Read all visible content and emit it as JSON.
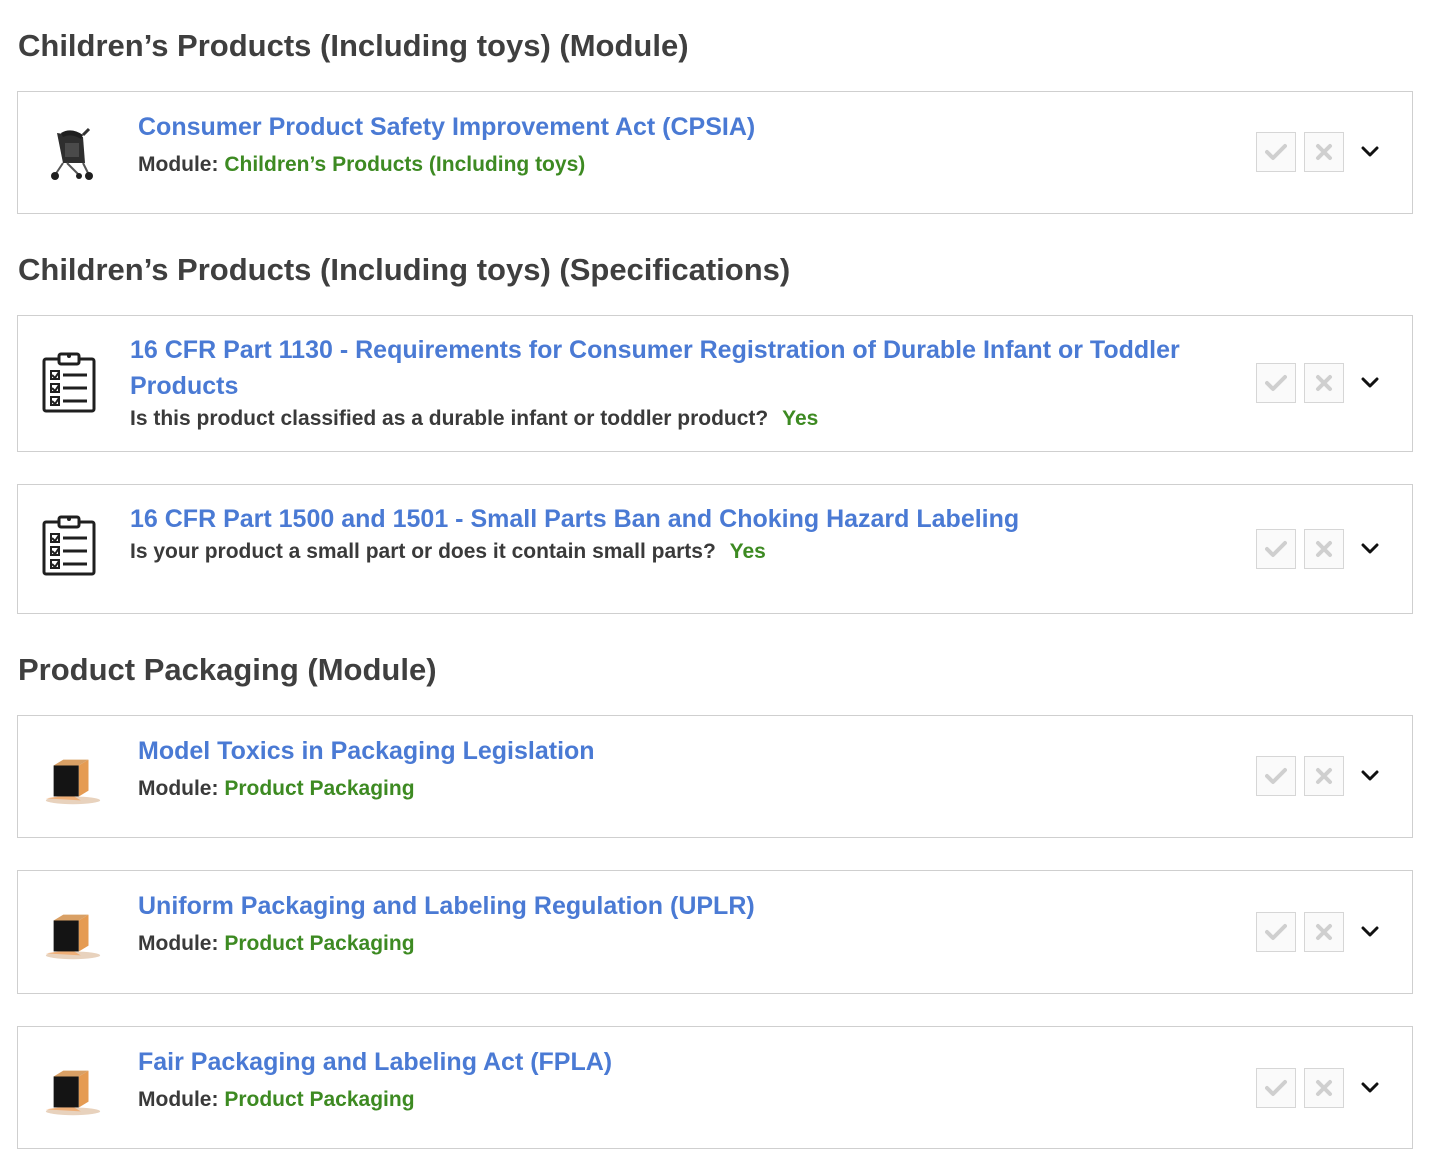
{
  "sections": [
    {
      "title": "Children’s Products (Including toys) (Module)",
      "cards": [
        {
          "icon": "stroller-icon",
          "title": "Consumer Product Safety Improvement Act (CPSIA)",
          "sub_label": "Module:",
          "sub_value": "Children’s Products (Including toys)"
        }
      ]
    },
    {
      "title": "Children’s Products (Including toys) (Specifications)",
      "cards": [
        {
          "icon": "checklist-clipboard-icon",
          "title": "16 CFR Part 1130 - Requirements for Consumer Registration of Durable Infant or Toddler Products",
          "question": "Is this product classified as a durable infant or toddler product?",
          "answer": "Yes"
        },
        {
          "icon": "checklist-clipboard-icon",
          "title": "16 CFR Part 1500 and 1501 - Small Parts Ban and Choking Hazard Labeling",
          "question": "Is your product a small part or does it contain small parts?",
          "answer": "Yes"
        }
      ]
    },
    {
      "title": "Product Packaging (Module)",
      "cards": [
        {
          "icon": "box-icon",
          "title": "Model Toxics in Packaging Legislation",
          "sub_label": "Module:",
          "sub_value": "Product Packaging"
        },
        {
          "icon": "box-icon",
          "title": "Uniform Packaging and Labeling Regulation (UPLR)",
          "sub_label": "Module:",
          "sub_value": "Product Packaging"
        },
        {
          "icon": "box-icon",
          "title": "Fair Packaging and Labeling Act (FPLA)",
          "sub_label": "Module:",
          "sub_value": "Product Packaging"
        }
      ]
    }
  ],
  "colors": {
    "link": "#4a7ad4",
    "module_value": "#3d8a22",
    "heading": "#3f3f3f",
    "border": "#cfcfcf",
    "action_icon": "#cfcfcf"
  },
  "action_icons": [
    "check-icon",
    "x-icon",
    "chevron-down-icon"
  ]
}
